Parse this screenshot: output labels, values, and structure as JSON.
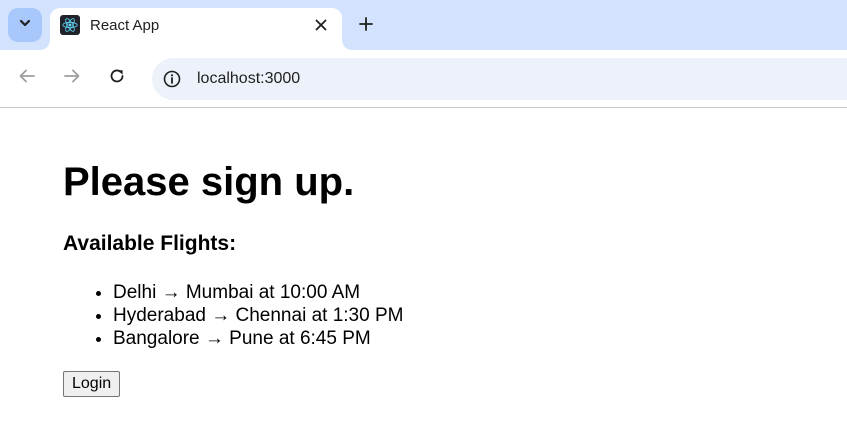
{
  "browser": {
    "tab": {
      "title": "React App",
      "favicon": "react-logo-icon"
    },
    "icons": {
      "tab_search": "chevron-down-icon",
      "tab_close": "close-icon",
      "new_tab": "plus-icon",
      "back": "arrow-left-icon",
      "forward": "arrow-right-icon",
      "reload": "reload-icon",
      "site_info": "info-icon"
    },
    "url": "localhost:3000"
  },
  "page": {
    "heading": "Please sign up.",
    "subheading": "Available Flights:",
    "flights": [
      "Delhi → Mumbai at 10:00 AM",
      "Hyderabad → Chennai at 1:30 PM",
      "Bangalore → Pune at 6:45 PM"
    ],
    "login_label": "Login"
  },
  "colors": {
    "tabstrip": "#d3e3fd",
    "tab_search_bg": "#a8c7fa",
    "omnibox_bg": "#edf2fa",
    "react_blue": "#61dafb"
  }
}
